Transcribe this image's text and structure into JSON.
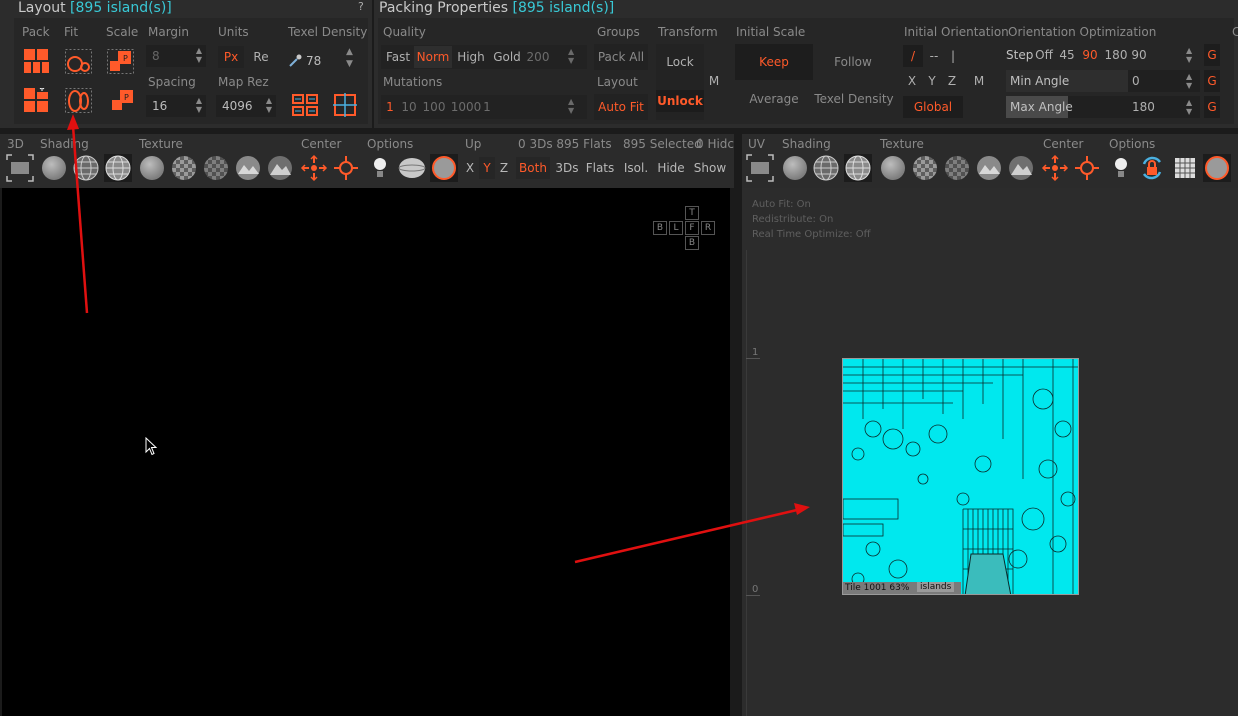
{
  "layout_panel": {
    "title": "Layout",
    "count": "[895 island(s)]",
    "help": "?",
    "labels": {
      "pack": "Pack",
      "fit": "Fit",
      "scale": "Scale",
      "margin": "Margin",
      "units": "Units",
      "texel_density": "Texel Density",
      "spacing": "Spacing",
      "map_rez": "Map Rez"
    },
    "margin_value": "8",
    "spacing_value": "16",
    "units_px": "Px",
    "units_re": "Re",
    "texel_value": "78",
    "map_rez_value": "4096"
  },
  "packing_panel": {
    "title": "Packing Properties",
    "count": "[895 island(s)]",
    "labels": {
      "quality": "Quality",
      "groups": "Groups",
      "transform": "Transform",
      "initial_scale": "Initial Scale",
      "initial_orientation": "Initial Orientation",
      "orientation_optimization": "Orientation Optimization",
      "mutations": "Mutations",
      "layout": "Layout"
    },
    "quality_options": [
      "Fast",
      "Norm",
      "High",
      "Gold"
    ],
    "quality_value": "200",
    "pack_all": "Pack All",
    "auto_fit": "Auto Fit",
    "lock": "Lock",
    "unlock": "Unlock",
    "m": "M",
    "keep": "Keep",
    "follow": "Follow",
    "average": "Average",
    "texel_density_btn": "Texel Density",
    "orient_row1": [
      "/",
      "--",
      "|"
    ],
    "orient_row2": [
      "X",
      "Y",
      "Z",
      "M"
    ],
    "global": "Global",
    "mutation_options": [
      "1",
      "10",
      "100",
      "1000"
    ],
    "mutation_value": "1",
    "step": "Step",
    "step_options": [
      "Off",
      "45",
      "90",
      "180"
    ],
    "step_value": "90",
    "min_angle": "Min Angle",
    "min_angle_value": "0",
    "max_angle": "Max Angle",
    "max_angle_value": "180",
    "g": "G",
    "cutoff_label": "C"
  },
  "view3d": {
    "labels": {
      "3d": "3D",
      "shading": "Shading",
      "texture": "Texture",
      "center": "Center",
      "options": "Options",
      "up": "Up"
    },
    "stats": "0 3Ds 895 Flats",
    "selected": "895 Selected",
    "hidden": "0 Hidc",
    "axes": [
      "X",
      "Y",
      "Z"
    ],
    "buttons": [
      "Both",
      "3Ds",
      "Flats",
      "Isol.",
      "Hide",
      "Show"
    ],
    "nav_cube": {
      "top": "T",
      "left_b": "B",
      "left": "L",
      "front": "F",
      "right": "R",
      "bottom": "B"
    }
  },
  "viewuv": {
    "labels": {
      "uv": "UV",
      "shading": "Shading",
      "texture": "Texture",
      "center": "Center",
      "options": "Options"
    },
    "overlay": [
      "Auto Fit: On",
      "Redistribute: On",
      "Real Time Optimize: Off"
    ],
    "ruler_one": "1",
    "ruler_zero": "0",
    "tile_label": "Tile 1001 63%",
    "islands_label": "islands"
  },
  "colors": {
    "accent": "#ff5a2a",
    "cyan": "#00f0f0",
    "count": "#39c9d6",
    "arrow": "#e01010"
  }
}
